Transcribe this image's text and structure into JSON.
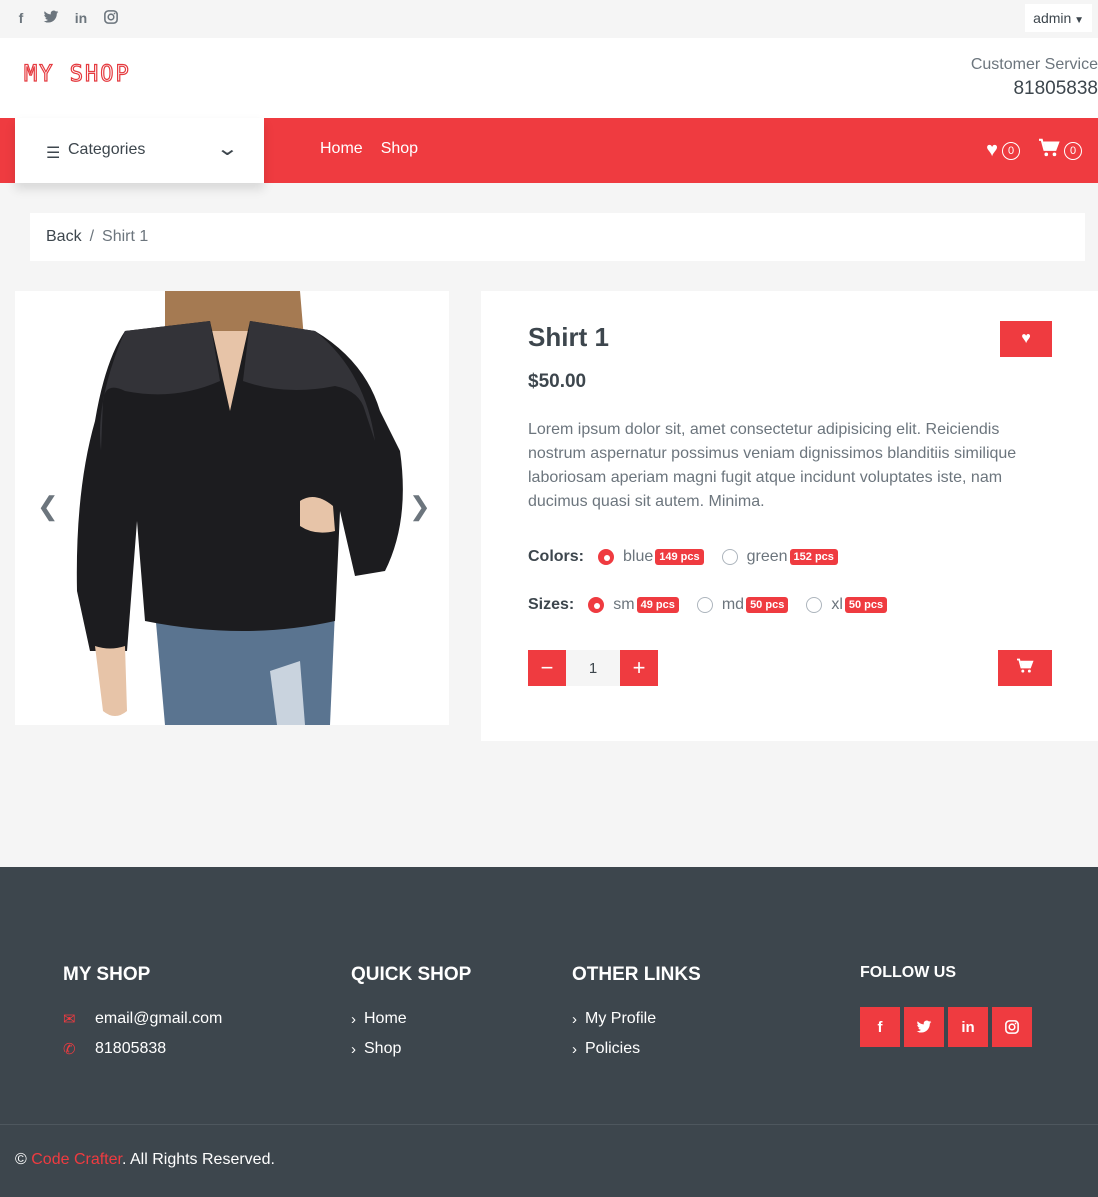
{
  "topbar": {
    "social": [
      {
        "icon": "facebook-icon",
        "glyph": "f"
      },
      {
        "icon": "twitter-icon",
        "glyph": "🐦"
      },
      {
        "icon": "linkedin-icon",
        "glyph": "in"
      },
      {
        "icon": "instagram-icon",
        "glyph": "◎"
      }
    ],
    "user_label": "admin"
  },
  "header": {
    "logo": "MY SHOP",
    "customer_service_label": "Customer Service",
    "customer_service_phone": "81805838"
  },
  "navbar": {
    "categories_label": "Categories",
    "links": [
      "Home",
      "Shop"
    ],
    "wishlist_count": "0",
    "cart_count": "0",
    "accent_color": "#ef3b40"
  },
  "breadcrumb": {
    "back": "Back",
    "separator": "/",
    "current": "Shirt 1"
  },
  "product": {
    "title": "Shirt 1",
    "price": "$50.00",
    "description": "Lorem ipsum dolor sit, amet consectetur adipisicing elit. Reiciendis nostrum aspernatur possimus veniam dignissimos blanditiis similique laboriosam aperiam magni fugit atque incidunt voluptates iste, nam ducimus quasi sit autem. Minima.",
    "colors_label": "Colors:",
    "colors": [
      {
        "name": "blue",
        "stock": "149 pcs",
        "selected": true
      },
      {
        "name": "green",
        "stock": "152 pcs",
        "selected": false
      }
    ],
    "sizes_label": "Sizes:",
    "sizes": [
      {
        "name": "sm",
        "stock": "49 pcs",
        "selected": true
      },
      {
        "name": "md",
        "stock": "50 pcs",
        "selected": false
      },
      {
        "name": "xl",
        "stock": "50 pcs",
        "selected": false
      }
    ],
    "quantity": "1"
  },
  "footer": {
    "col1": {
      "title": "MY SHOP",
      "email": "email@gmail.com",
      "phone": "81805838"
    },
    "col2": {
      "title": "QUICK SHOP",
      "links": [
        "Home",
        "Shop"
      ]
    },
    "col3": {
      "title": "OTHER LINKS",
      "links": [
        "My Profile",
        "Policies"
      ]
    },
    "follow_title": "FOLLOW US",
    "copyright_symbol": "©",
    "brand": "Code Crafter",
    "rights": ". All Rights Reserved."
  }
}
